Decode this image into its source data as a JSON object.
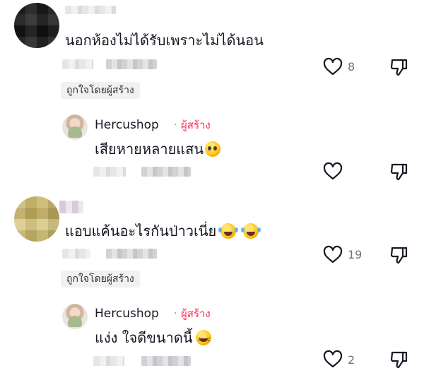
{
  "comments": [
    {
      "text": "นอกห้องไม่ได้รับเพราะไม่ได้นอน",
      "likes": "8",
      "liked_by_creator_label": "ถูกใจโดยผู้สร้าง",
      "reply": {
        "username": "Hercushop",
        "separator": "·",
        "creator_label": "ผู้สร้าง",
        "text": "เสียหายหลายแสน",
        "emoji": "pleading-face"
      }
    },
    {
      "text": "แอบแค้นอะไรกันป่าวเนี่ย",
      "emoji": [
        "rolling-laughing-face",
        "rolling-laughing-face"
      ],
      "likes": "19",
      "liked_by_creator_label": "ถูกใจโดยผู้สร้าง",
      "reply": {
        "username": "Hercushop",
        "separator": "·",
        "creator_label": "ผู้สร้าง",
        "text": "แง่ง ใจดีขนาดนี้",
        "emoji": "grinning-squinting-face",
        "likes": "2"
      }
    }
  ],
  "colors": {
    "creator_accent": "#fe2c55",
    "count_gray": "#73747b",
    "chip_bg": "#f1f1f2"
  }
}
